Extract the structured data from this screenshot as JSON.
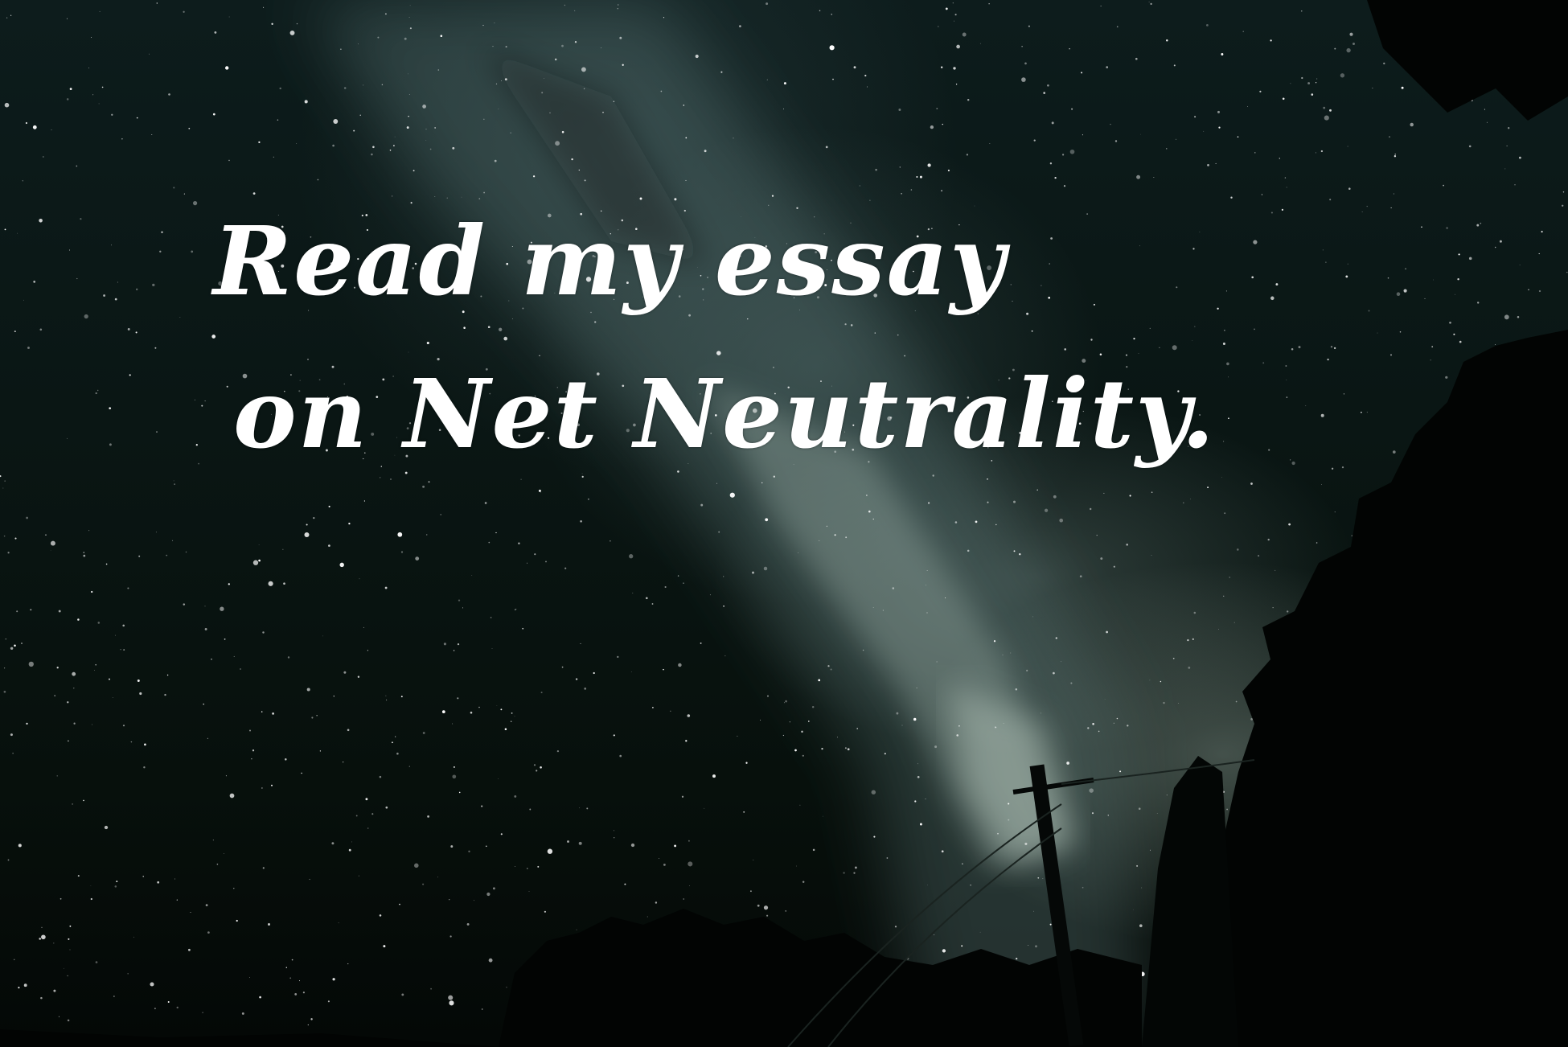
{
  "headline": {
    "line1": "Read my essay",
    "line2": "on Net Neutrality."
  },
  "colors": {
    "sky_dark": "#07100c",
    "sky_mid": "#0d1c1c",
    "milky_way_glow": "#b4c8be",
    "text": "#ffffff",
    "tree_silhouette": "#020403"
  }
}
